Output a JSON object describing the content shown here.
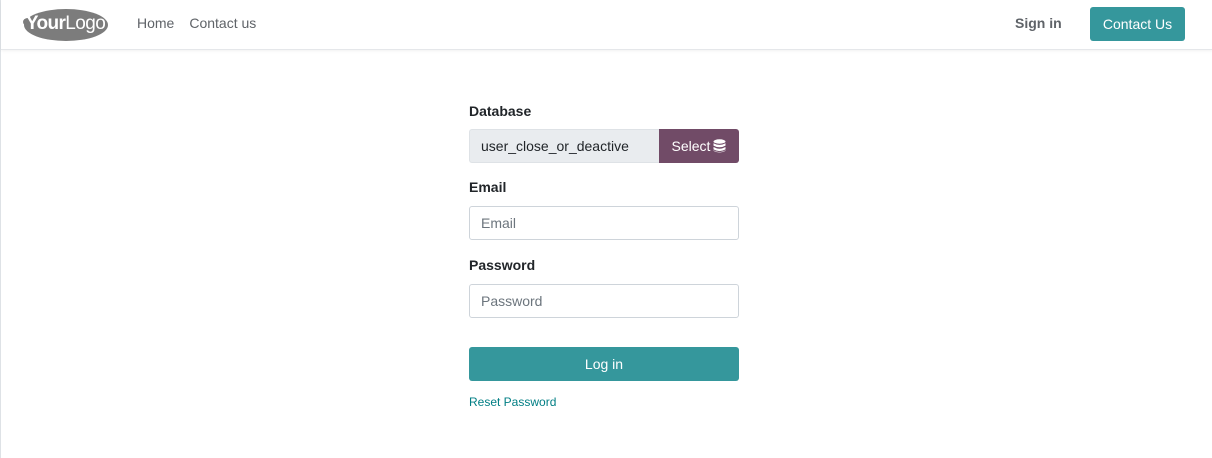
{
  "header": {
    "logo": {
      "text_bold": "Your",
      "text_light": "Logo"
    },
    "nav": [
      {
        "label": "Home"
      },
      {
        "label": "Contact us"
      }
    ],
    "sign_in_label": "Sign in",
    "contact_button_label": "Contact Us"
  },
  "form": {
    "database": {
      "label": "Database",
      "value": "user_close_or_deactive",
      "select_label": "Select",
      "select_icon": "database-icon"
    },
    "email": {
      "label": "Email",
      "placeholder": "Email",
      "value": ""
    },
    "password": {
      "label": "Password",
      "placeholder": "Password",
      "value": ""
    },
    "login_button_label": "Log in",
    "reset_link_label": "Reset Password"
  },
  "colors": {
    "primary": "#35979c",
    "secondary": "#714b67",
    "link": "#017e84",
    "logo_bg": "#7c7c7c"
  }
}
